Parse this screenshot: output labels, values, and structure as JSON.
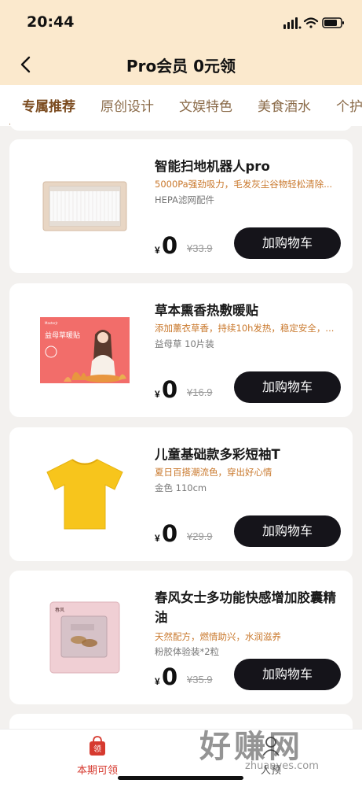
{
  "status_bar": {
    "time": "20:44"
  },
  "nav": {
    "title": "Pro会员 0元领"
  },
  "tabs": [
    {
      "label": "专属推荐",
      "active": true
    },
    {
      "label": "原创设计",
      "active": false
    },
    {
      "label": "文娱特色",
      "active": false
    },
    {
      "label": "美食酒水",
      "active": false
    },
    {
      "label": "个护",
      "active": false
    }
  ],
  "products": [
    {
      "title": "智能扫地机器人pro",
      "desc": "5000Pa强劲吸力，毛发灰尘谷物轻松清除...",
      "spec": "HEPA滤网配件",
      "currency": "¥",
      "price": "0",
      "original_price": "¥33.9",
      "button": "加购物车",
      "image": "hepa-filter"
    },
    {
      "title": "草本熏香热敷暖贴",
      "desc": "添加薰衣草香，持续10h发热，稳定安全，...",
      "spec": "益母草 10片装",
      "currency": "¥",
      "price": "0",
      "original_price": "¥16.9",
      "button": "加购物车",
      "image": "warmer-patch",
      "image_text": "益母草暖贴"
    },
    {
      "title": "儿童基础款多彩短袖T",
      "desc": "夏日百搭潮流色，穿出好心情",
      "spec": "金色 110cm",
      "currency": "¥",
      "price": "0",
      "original_price": "¥29.9",
      "button": "加购物车",
      "image": "yellow-tshirt"
    },
    {
      "title": "春风女士多功能快感增加胶囊精油",
      "desc": "天然配方，燃情助兴，水润滋养",
      "spec": "粉胶体验装*2粒",
      "currency": "¥",
      "price": "0",
      "original_price": "¥35.9",
      "button": "加购物车",
      "image": "capsule-pack"
    }
  ],
  "bottom_bar": {
    "tabs": [
      {
        "label": "本期可领",
        "icon": "gift-bag-icon",
        "active": true
      },
      {
        "label": "人预",
        "icon": "user-icon",
        "active": false
      }
    ]
  },
  "watermark": {
    "main": "好赚网",
    "sub": "zhuanyes.com"
  },
  "colors": {
    "header_bg": "#fbe9cd",
    "accent": "#c9782c",
    "button_bg": "#15141a",
    "active_tab": "#7a4a1e",
    "bottom_active": "#d63a2f"
  }
}
